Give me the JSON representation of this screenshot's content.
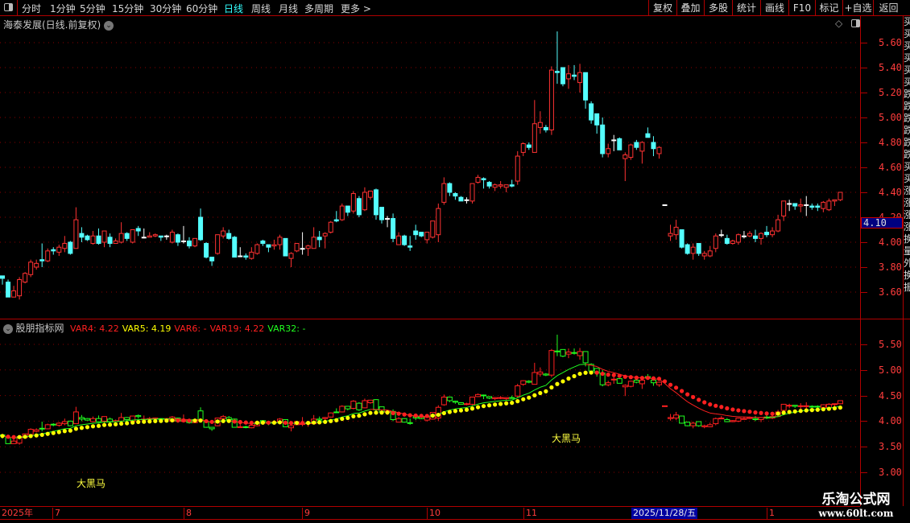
{
  "toolbar": {
    "periods": [
      {
        "label": "分时"
      },
      {
        "label": "1分钟"
      },
      {
        "label": "5分钟"
      },
      {
        "label": "15分钟"
      },
      {
        "label": "30分钟"
      },
      {
        "label": "60分钟"
      },
      {
        "label": "日线",
        "active": true
      },
      {
        "label": "周线"
      },
      {
        "label": "月线"
      },
      {
        "label": "多周期"
      },
      {
        "label": "更多 >"
      }
    ],
    "buttons": [
      {
        "label": "复权"
      },
      {
        "label": "叠加"
      },
      {
        "label": "多股"
      },
      {
        "label": "统计"
      },
      {
        "label": "画线"
      },
      {
        "label": "F10"
      },
      {
        "label": "标记"
      },
      {
        "label": "+自选"
      },
      {
        "label": "返回"
      }
    ]
  },
  "main_chart": {
    "title": "海泰发展(日线.前复权)",
    "price_ticks": [
      "5.60",
      "5.40",
      "5.20",
      "5.00",
      "4.80",
      "4.60",
      "4.40",
      "4.20",
      "4.00",
      "3.80",
      "3.60"
    ],
    "current_price": "4.10",
    "colors": {
      "up": "#ff3232",
      "down": "#54ffff",
      "flat": "#ffffff",
      "grid": "#8b0000"
    }
  },
  "indicator": {
    "name": "股朋指标网",
    "vars": [
      {
        "label": "VAR4: 4.22",
        "color": "#ff2020"
      },
      {
        "label": "VAR5: 4.19",
        "color": "#ffff00"
      },
      {
        "label": "VAR6: -",
        "color": "#ff2020"
      },
      {
        "label": "VAR19: 4.22",
        "color": "#ff2020"
      },
      {
        "label": "VAR32: -",
        "color": "#20ff20"
      }
    ],
    "price_ticks": [
      "5.50",
      "5.00",
      "4.50",
      "4.00",
      "3.50",
      "3.00"
    ],
    "signal_labels": [
      "大黑马",
      "大黑马"
    ],
    "colors": {
      "up": "#ff2020",
      "down": "#20ff20",
      "dot_up": "#ffff00",
      "dot_down": "#ff2020"
    }
  },
  "date_axis": {
    "year": "2025年",
    "months": [
      "7",
      "8",
      "9",
      "10",
      "11",
      "1"
    ],
    "cursor_date": "2025/11/28/五"
  },
  "watermark": {
    "name": "乐淘公式网",
    "url": "www.60lt.com"
  },
  "chart_data": {
    "type": "candlestick",
    "fields": [
      "open",
      "close",
      "high",
      "low"
    ],
    "ylim": [
      3.45,
      5.75
    ],
    "candles": [
      [
        3.73,
        3.71,
        3.73,
        3.66
      ],
      [
        3.68,
        3.56,
        3.7,
        3.56
      ],
      [
        3.56,
        3.61,
        3.65,
        3.56
      ],
      [
        3.57,
        3.7,
        3.72,
        3.54
      ],
      [
        3.68,
        3.75,
        3.76,
        3.67
      ],
      [
        3.74,
        3.84,
        3.86,
        3.72
      ],
      [
        3.8,
        3.83,
        3.86,
        3.78
      ],
      [
        3.86,
        3.85,
        3.99,
        3.8
      ],
      [
        3.85,
        3.93,
        3.95,
        3.84
      ],
      [
        3.94,
        3.93,
        3.96,
        3.9
      ],
      [
        3.92,
        3.96,
        3.98,
        3.89
      ],
      [
        3.95,
        3.99,
        4.05,
        3.92
      ],
      [
        4.0,
        3.91,
        4.01,
        3.9
      ],
      [
        3.95,
        4.18,
        4.28,
        3.95
      ],
      [
        4.07,
        4.04,
        4.12,
        4.0
      ],
      [
        4.05,
        4.02,
        4.06,
        4.01
      ],
      [
        3.99,
        4.05,
        4.09,
        3.98
      ],
      [
        4.05,
        3.99,
        4.11,
        3.98
      ],
      [
        4.0,
        4.09,
        4.09,
        3.96
      ],
      [
        4.04,
        3.99,
        4.07,
        3.96
      ],
      [
        3.99,
        4.01,
        4.03,
        3.99
      ],
      [
        4.0,
        4.07,
        4.16,
        3.99
      ],
      [
        4.07,
        4.03,
        4.08,
        4.01
      ],
      [
        4.0,
        4.1,
        4.1,
        3.99
      ],
      [
        4.11,
        4.09,
        4.13,
        4.05
      ],
      [
        4.04,
        4.04,
        4.11,
        4.03
      ],
      [
        4.04,
        4.05,
        4.08,
        4.04
      ],
      [
        4.05,
        4.06,
        4.07,
        4.04
      ],
      [
        4.05,
        4.04,
        4.05,
        4.01
      ],
      [
        4.05,
        4.05,
        4.06,
        4.02
      ],
      [
        4.0,
        4.08,
        4.1,
        3.99
      ],
      [
        4.06,
        4.0,
        4.07,
        3.97
      ],
      [
        4.01,
        4.01,
        4.13,
        3.99
      ],
      [
        4.01,
        3.97,
        4.04,
        3.95
      ],
      [
        3.97,
        4.03,
        4.03,
        3.96
      ],
      [
        4.2,
        4.02,
        4.27,
        4.01
      ],
      [
        3.99,
        3.88,
        4.0,
        3.87
      ],
      [
        3.88,
        3.85,
        3.88,
        3.81
      ],
      [
        3.91,
        4.06,
        4.06,
        3.9
      ],
      [
        4.05,
        4.09,
        4.12,
        4.03
      ],
      [
        4.07,
        4.03,
        4.1,
        4.02
      ],
      [
        4.04,
        3.88,
        4.05,
        3.88
      ],
      [
        3.89,
        3.89,
        3.96,
        3.88
      ],
      [
        3.89,
        3.88,
        3.91,
        3.86
      ],
      [
        3.87,
        3.92,
        3.96,
        3.86
      ],
      [
        3.91,
        3.98,
        3.99,
        3.9
      ],
      [
        4.01,
        3.99,
        4.02,
        3.97
      ],
      [
        3.98,
        3.96,
        3.98,
        3.92
      ],
      [
        3.97,
        3.98,
        4.02,
        3.94
      ],
      [
        3.98,
        4.04,
        4.06,
        3.94
      ],
      [
        4.03,
        3.89,
        4.03,
        3.89
      ],
      [
        3.87,
        3.91,
        3.92,
        3.8
      ],
      [
        3.93,
        3.99,
        3.99,
        3.92
      ],
      [
        3.95,
        3.95,
        4.08,
        3.9
      ],
      [
        3.95,
        3.97,
        3.98,
        3.89
      ],
      [
        3.95,
        4.04,
        4.12,
        3.95
      ],
      [
        4.04,
        4.02,
        4.09,
        3.96
      ],
      [
        4.05,
        4.07,
        4.08,
        3.95
      ],
      [
        4.08,
        4.16,
        4.17,
        4.07
      ],
      [
        4.18,
        4.17,
        4.25,
        4.16
      ],
      [
        4.18,
        4.29,
        4.31,
        4.17
      ],
      [
        4.29,
        4.24,
        4.29,
        4.21
      ],
      [
        4.25,
        4.39,
        4.41,
        4.23
      ],
      [
        4.35,
        4.22,
        4.37,
        4.2
      ],
      [
        4.26,
        4.4,
        4.44,
        4.25
      ],
      [
        4.36,
        4.41,
        4.41,
        4.34
      ],
      [
        4.42,
        4.22,
        4.43,
        4.18
      ],
      [
        4.28,
        4.18,
        4.28,
        4.15
      ],
      [
        4.19,
        4.19,
        4.21,
        4.12
      ],
      [
        4.19,
        4.03,
        4.23,
        4.0
      ],
      [
        3.98,
        4.05,
        4.08,
        3.98
      ],
      [
        4.05,
        3.98,
        4.06,
        3.97
      ],
      [
        3.97,
        3.96,
        4.05,
        3.93
      ],
      [
        4.09,
        4.06,
        4.14,
        4.02
      ],
      [
        4.08,
        4.05,
        4.08,
        4.04
      ],
      [
        4.02,
        4.08,
        4.08,
        3.99
      ],
      [
        4.04,
        4.17,
        4.17,
        4.03
      ],
      [
        4.06,
        4.27,
        4.31,
        4.0
      ],
      [
        4.32,
        4.47,
        4.52,
        4.3
      ],
      [
        4.47,
        4.4,
        4.48,
        4.37
      ],
      [
        4.39,
        4.37,
        4.4,
        4.34
      ],
      [
        4.36,
        4.33,
        4.37,
        4.33
      ],
      [
        4.34,
        4.34,
        4.36,
        4.31
      ],
      [
        4.33,
        4.47,
        4.47,
        4.31
      ],
      [
        4.48,
        4.52,
        4.54,
        4.47
      ],
      [
        4.51,
        4.5,
        4.52,
        4.43
      ],
      [
        4.48,
        4.45,
        4.49,
        4.43
      ],
      [
        4.44,
        4.46,
        4.47,
        4.41
      ],
      [
        4.45,
        4.46,
        4.49,
        4.43
      ],
      [
        4.44,
        4.46,
        4.46,
        4.4
      ],
      [
        4.46,
        4.45,
        4.5,
        4.44
      ],
      [
        4.49,
        4.69,
        4.73,
        4.46
      ],
      [
        4.72,
        4.79,
        4.8,
        4.69
      ],
      [
        4.78,
        4.76,
        4.8,
        4.74
      ],
      [
        4.72,
        4.95,
        5.14,
        4.72
      ],
      [
        4.92,
        4.96,
        5.05,
        4.87
      ],
      [
        4.92,
        4.9,
        4.94,
        4.88
      ],
      [
        4.9,
        5.38,
        5.41,
        4.86
      ],
      [
        5.37,
        5.36,
        5.69,
        5.27
      ],
      [
        5.4,
        5.27,
        5.4,
        5.25
      ],
      [
        5.31,
        5.35,
        5.42,
        5.23
      ],
      [
        5.34,
        5.33,
        5.42,
        5.3
      ],
      [
        5.28,
        5.36,
        5.43,
        5.2
      ],
      [
        5.36,
        5.14,
        5.36,
        5.07
      ],
      [
        5.11,
        4.98,
        5.13,
        4.95
      ],
      [
        5.03,
        4.94,
        5.03,
        4.87
      ],
      [
        4.94,
        4.71,
        5.0,
        4.68
      ],
      [
        4.71,
        4.75,
        4.79,
        4.68
      ],
      [
        4.82,
        4.82,
        4.86,
        4.73
      ],
      [
        4.83,
        4.74,
        4.84,
        4.74
      ],
      [
        4.67,
        4.7,
        4.72,
        4.49
      ],
      [
        4.68,
        4.78,
        4.79,
        4.66
      ],
      [
        4.8,
        4.76,
        4.82,
        4.74
      ],
      [
        4.73,
        4.8,
        4.81,
        4.63
      ],
      [
        4.87,
        4.84,
        4.92,
        4.84
      ],
      [
        4.8,
        4.75,
        4.85,
        4.69
      ],
      [
        4.71,
        4.76,
        4.77,
        4.67
      ],
      [
        4.3,
        4.3,
        4.3,
        4.3
      ],
      [
        4.05,
        4.07,
        4.14,
        4.01
      ],
      [
        4.06,
        4.12,
        4.18,
        4.02
      ],
      [
        4.1,
        3.96,
        4.1,
        3.95
      ],
      [
        3.98,
        3.91,
        3.99,
        3.9
      ],
      [
        3.91,
        3.96,
        3.99,
        3.86
      ],
      [
        3.99,
        3.91,
        3.99,
        3.89
      ],
      [
        3.89,
        3.91,
        3.93,
        3.86
      ],
      [
        3.89,
        3.93,
        3.97,
        3.88
      ],
      [
        3.95,
        4.05,
        4.07,
        3.92
      ],
      [
        4.06,
        4.06,
        4.1,
        4.04
      ],
      [
        4.03,
        3.99,
        4.06,
        3.98
      ],
      [
        3.99,
        4.01,
        4.02,
        3.98
      ],
      [
        4.0,
        4.06,
        4.07,
        3.98
      ],
      [
        4.05,
        4.05,
        4.09,
        4.03
      ],
      [
        4.05,
        4.07,
        4.09,
        4.04
      ],
      [
        4.05,
        4.03,
        4.1,
        4.0
      ],
      [
        4.03,
        4.07,
        4.08,
        3.98
      ],
      [
        4.08,
        4.06,
        4.13,
        4.04
      ],
      [
        4.06,
        4.09,
        4.12,
        4.04
      ],
      [
        4.09,
        4.18,
        4.22,
        4.08
      ],
      [
        4.21,
        4.33,
        4.33,
        4.17
      ],
      [
        4.31,
        4.31,
        4.34,
        4.25
      ],
      [
        4.31,
        4.29,
        4.31,
        4.26
      ],
      [
        4.29,
        4.3,
        4.35,
        4.24
      ],
      [
        4.3,
        4.3,
        4.37,
        4.21
      ],
      [
        4.29,
        4.28,
        4.31,
        4.26
      ],
      [
        4.29,
        4.28,
        4.31,
        4.25
      ],
      [
        4.27,
        4.32,
        4.33,
        4.24
      ],
      [
        4.26,
        4.33,
        4.35,
        4.25
      ],
      [
        4.33,
        4.34,
        4.34,
        4.29
      ],
      [
        4.34,
        4.4,
        4.4,
        4.33
      ]
    ]
  }
}
